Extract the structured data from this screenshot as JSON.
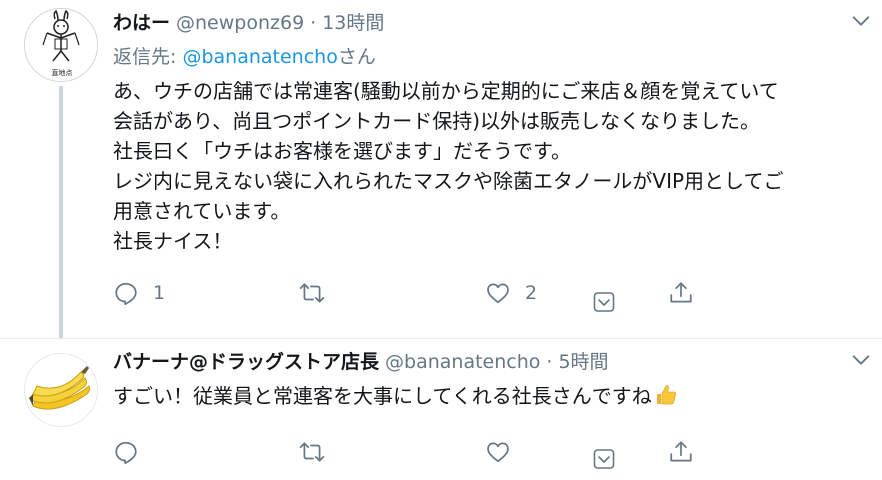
{
  "tweets": [
    {
      "name": "わはー",
      "handle": "@newponz69",
      "dot": "·",
      "time": "13時間",
      "reply_prefix": "返信先: ",
      "reply_mention": "@bananatencho",
      "reply_suffix": "さん",
      "avatar_caption": "直地点",
      "lines": [
        "あ、ウチの店舗では常連客(騒動以前から定期的にご来店＆顔を覚えていて",
        "会話があり、尚且つポイントカード保持)以外は販売しなくなりました。",
        "社長曰く「ウチはお客様を選びます」だそうです。",
        "レジ内に見えない袋に入れられたマスクや除菌エタノールがVIP用としてご",
        "用意されています。",
        "社長ナイス！"
      ],
      "reply_count": "1",
      "retweet_count": "",
      "like_count": "2"
    },
    {
      "name": "バナーナ@ドラッグストア店長",
      "handle": "@bananatencho",
      "dot": "·",
      "time": "5時間",
      "text": "すごい！従業員と常連客を大事にしてくれる社長さんですね",
      "emoji": "thumbs-up",
      "reply_count": "",
      "retweet_count": "",
      "like_count": ""
    }
  ],
  "colors": {
    "text": "#14171a",
    "secondary": "#657786",
    "link": "#1b95e0",
    "thread_line": "#ccd6dd"
  },
  "icons": [
    "reply-icon",
    "retweet-icon",
    "like-icon",
    "share-icon",
    "dm-icon",
    "caret-down-icon"
  ]
}
